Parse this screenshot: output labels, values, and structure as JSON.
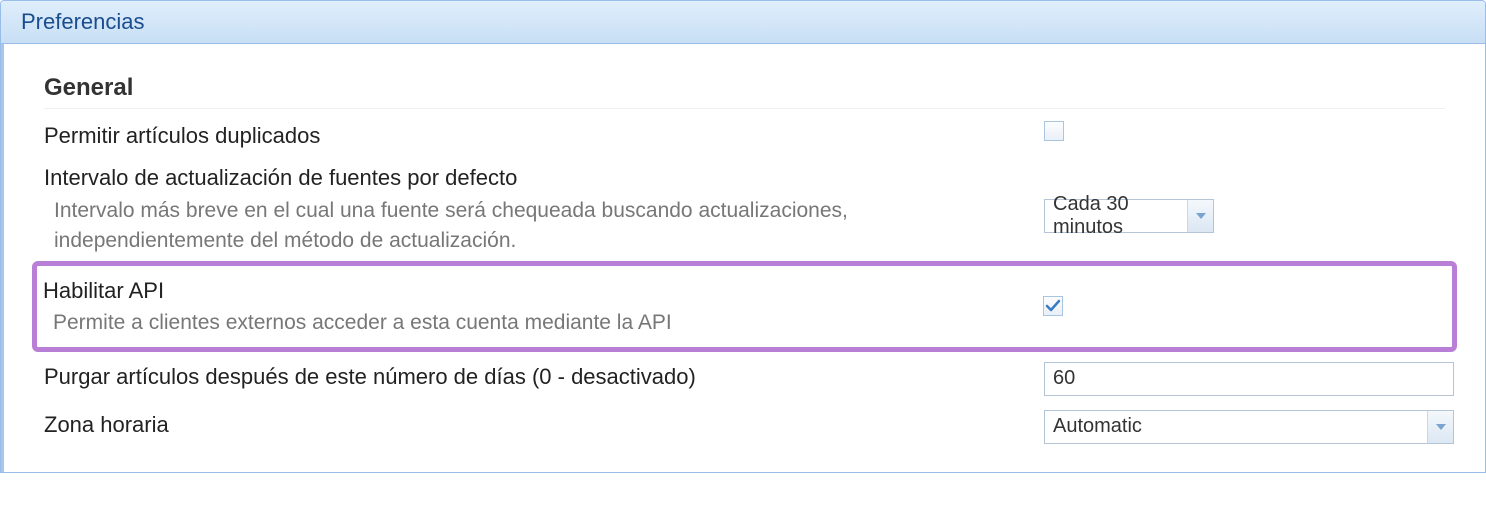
{
  "panel": {
    "title": "Preferencias"
  },
  "section": {
    "title": "General"
  },
  "allow_duplicates": {
    "label": "Permitir artículos duplicados",
    "checked": false
  },
  "update_interval": {
    "label": "Intervalo de actualización de fuentes por defecto",
    "desc": "Intervalo más breve en el cual una fuente será chequeada buscando actualizaciones, independientemente del método de actualización.",
    "value": "Cada 30 minutos"
  },
  "enable_api": {
    "label": "Habilitar API",
    "desc": "Permite a clientes externos acceder a esta cuenta mediante la API",
    "checked": true
  },
  "purge_days": {
    "label": "Purgar artículos después de este número de días (0 - desactivado)",
    "value": "60"
  },
  "timezone": {
    "label": "Zona horaria",
    "value": "Automatic"
  }
}
